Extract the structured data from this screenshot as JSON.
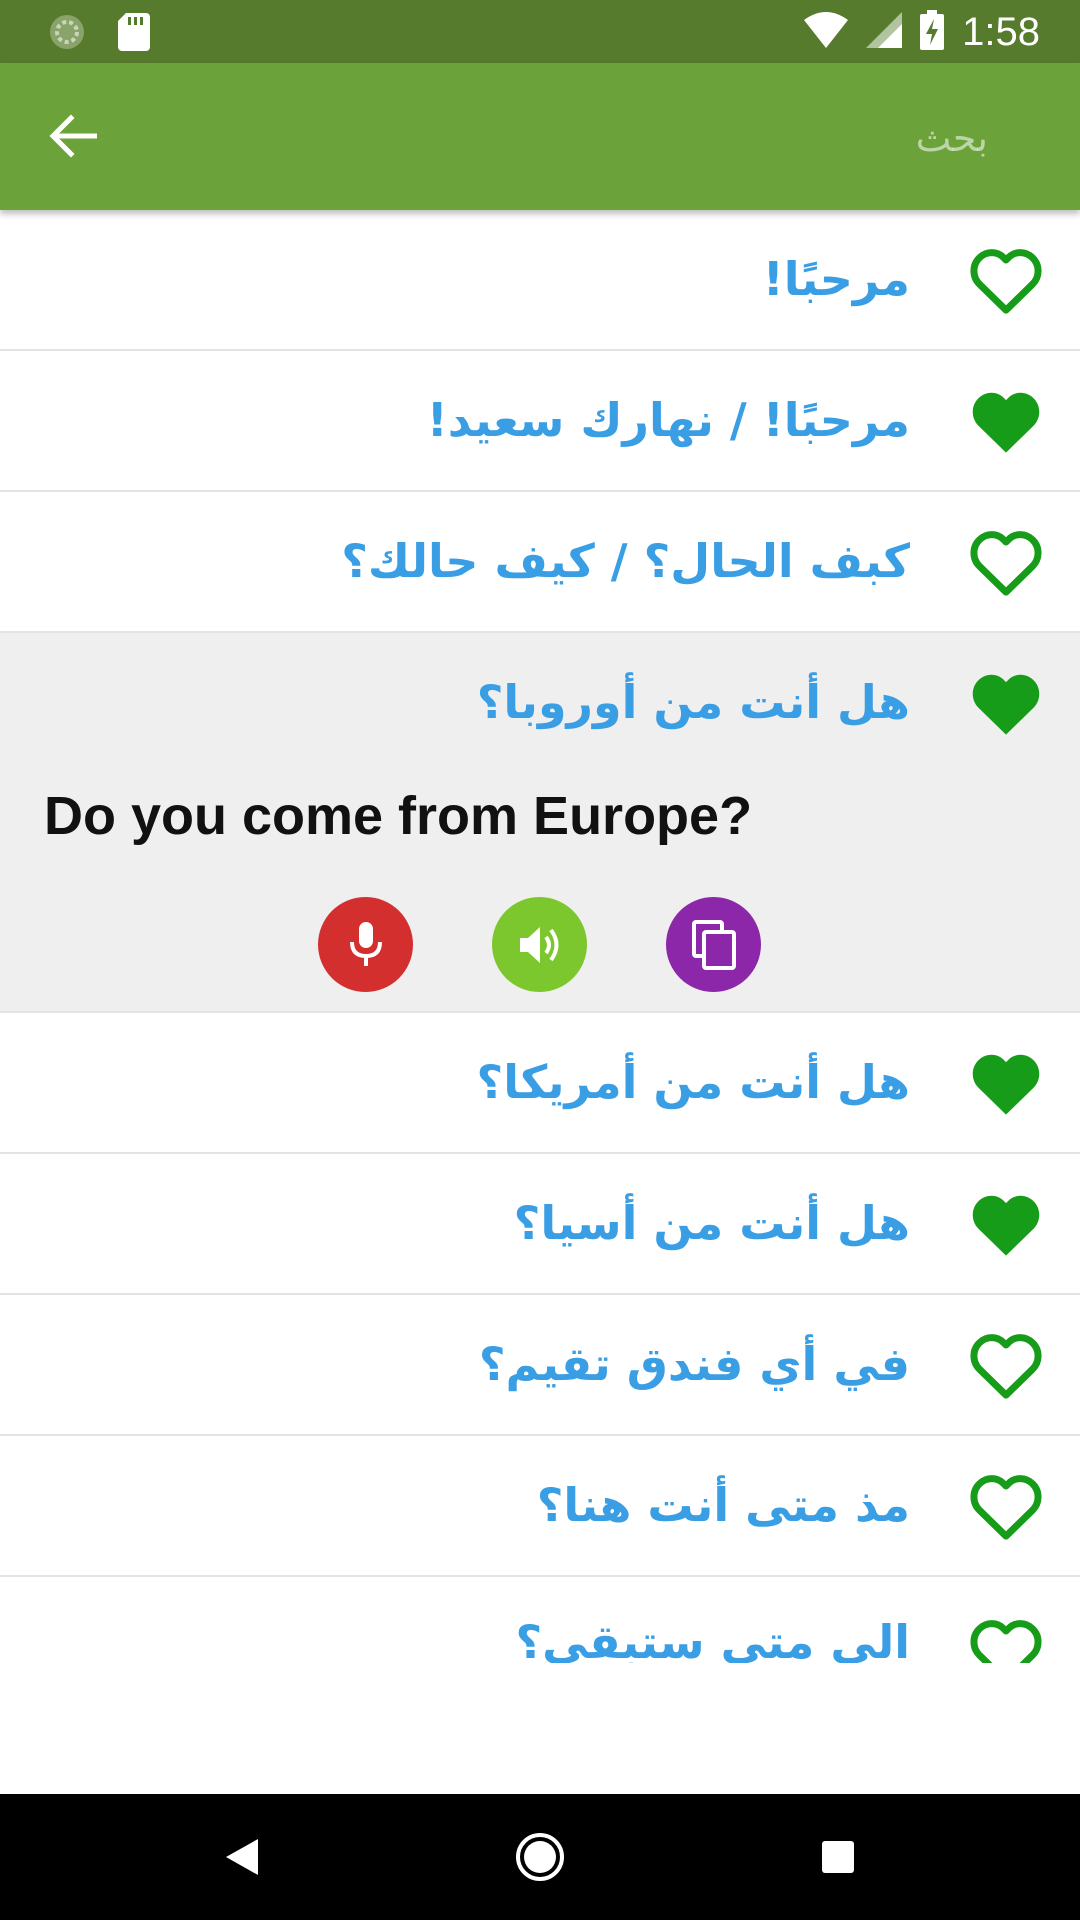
{
  "status_bar": {
    "time": "1:58"
  },
  "app_bar": {
    "search_placeholder": "بحث"
  },
  "colors": {
    "primary": "#6ca23a",
    "status_bar": "#567b2c",
    "phrase_text": "#3a9ee4",
    "heart_green": "#179c19",
    "mic": "#d32f2f",
    "speaker": "#7cc72e",
    "copy": "#8b27a8"
  },
  "phrases": [
    {
      "text": "مرحبًا!",
      "favorite": false
    },
    {
      "text": "مرحبًا! / نهارك سعيد!",
      "favorite": true
    },
    {
      "text": "كبف الحال؟ / كيف حالك؟",
      "favorite": false
    },
    {
      "text": "هل أنت من أوروبا؟",
      "favorite": true,
      "translation": "Do you come from Europe?"
    },
    {
      "text": "هل أنت من أمريكا؟",
      "favorite": true
    },
    {
      "text": "هل أنت من أسيا؟",
      "favorite": true
    },
    {
      "text": "في أي فندق تقيم؟",
      "favorite": false
    },
    {
      "text": "مذ متى أنت هنا؟",
      "favorite": false
    },
    {
      "text": "الى متى ستبقى؟",
      "favorite": false
    }
  ],
  "icons": {
    "back": "arrow-left-icon",
    "heart_filled": "heart-filled-icon",
    "heart_outline": "heart-outline-icon",
    "mic": "microphone-icon",
    "speaker": "speaker-icon",
    "copy": "copy-icon"
  }
}
